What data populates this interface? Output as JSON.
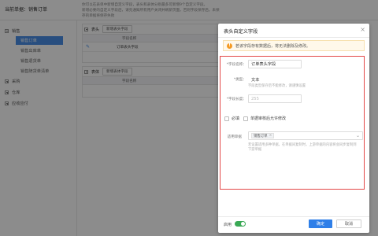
{
  "breadcrumb": "当前单据：销售订单",
  "notice_lines": [
    "你可以在表单中新增自定义字段，表头和表体分别最多可新增9个自定义字段。",
    "新增必要的自定义字段后，请先通知所有用户关闭并刷新页面，否则字段保存后，未保存的单据将保存失败"
  ],
  "sidebar": {
    "groups": [
      {
        "label": "销售",
        "expanded": true,
        "items": [
          "销售订单",
          "销售出库单",
          "销售退货单",
          "销售随货单清单"
        ]
      },
      {
        "label": "采购",
        "expanded": false
      },
      {
        "label": "仓库",
        "expanded": false
      },
      {
        "label": "应收应付",
        "expanded": false
      }
    ]
  },
  "header_section": {
    "title": "表头",
    "add_button": "新增表头字段",
    "col_header": "字段名称",
    "row_value": "订单表头字段"
  },
  "body_section": {
    "title": "表体",
    "add_button": "新增表体字段",
    "col_header": "字段名称"
  },
  "dialog": {
    "title": "表头自定义字段",
    "close_icon": "×",
    "warning": "若该字段存有数据后，将无法删除及修改。",
    "field_name_label": "*字段名称：",
    "field_name_value": "订单表头字段",
    "type_label": "*类型：",
    "type_value": "文本",
    "type_hint": "字段类型保存后不能修改，请谨慎设置",
    "length_label": "*字段长度：",
    "length_value": "255",
    "required_label": "必填",
    "editable_label": "单据审核后允许修改",
    "applicable_label": "适用单据",
    "applicable_tag": "销售订单",
    "applicable_hint": "若设置适用多种单据，在单据间复制时，上游单据的内容将会同步复制到下游单据",
    "enable_label": "启用",
    "confirm_button": "确定",
    "cancel_button": "取消"
  },
  "colors": {
    "accent": "#2f7fe8",
    "sidebar_active": "#4a8fe7",
    "highlight_box": "#e34747",
    "warning": "#f59a23",
    "toggle_on": "#3aa955"
  },
  "icons": {
    "warning": "warning-circle-icon",
    "close": "close-icon",
    "edit": "edit-icon",
    "tree_collapse": "collapse-box-icon",
    "tree_expand": "expand-box-icon",
    "dropdown": "chevron-down-icon",
    "tag_remove": "tag-close-icon"
  }
}
